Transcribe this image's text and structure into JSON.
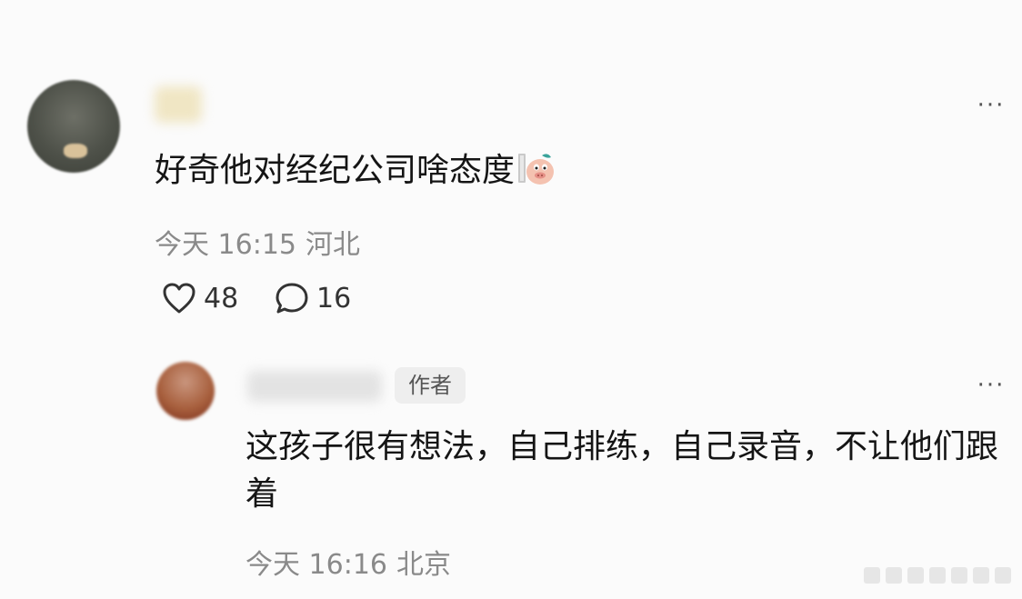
{
  "comment": {
    "text": "好奇他对经纪公司啥态度",
    "time": "今天 16:15",
    "location": "河北",
    "likes": "48",
    "replies": "16",
    "sticker_icon": "pig-face-sticker-icon",
    "more_label": "···"
  },
  "reply": {
    "author_badge": "作者",
    "text": "这孩子很有想法，自己排练，自己录音，不让他们跟着",
    "time": "今天 16:16",
    "location": "北京",
    "more_label": "···"
  },
  "colors": {
    "meta_text": "#8a8a8a",
    "badge_bg": "#eeeeee",
    "main_text": "#151515"
  }
}
